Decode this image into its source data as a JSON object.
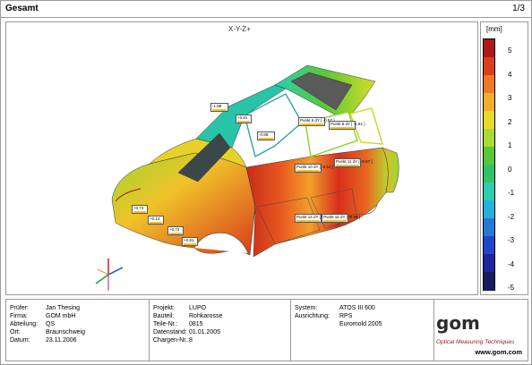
{
  "header": {
    "title": "Gesamt",
    "page": "1/3"
  },
  "view": {
    "label": "X-Y-Z+"
  },
  "legend": {
    "unit": "[mm]",
    "ticks": [
      "5",
      "4",
      "3",
      "2",
      "1",
      "0",
      "-1",
      "-2",
      "-3",
      "-4",
      "-5"
    ],
    "colors": [
      "#b01818",
      "#d8401c",
      "#ee7a22",
      "#f6ae2a",
      "#e8da2a",
      "#a8dc30",
      "#58c838",
      "#2fc46a",
      "#2ccdb0",
      "#28b0dc",
      "#2878d8",
      "#2046c8",
      "#1e249c",
      "#181a5e"
    ]
  },
  "callouts": [
    {
      "id": "c1",
      "text": "-1.88"
    },
    {
      "id": "c2",
      "text": "+0.81"
    },
    {
      "id": "c3",
      "text": "-0.89"
    },
    {
      "id": "c4",
      "text": "Punkt 6  dY [ -0.57 ]"
    },
    {
      "id": "c5",
      "text": "Punkt 8  dY [ -1.81 ]"
    },
    {
      "id": "c6",
      "text": "Punkt 10  dY [ -0.11 ]"
    },
    {
      "id": "c7",
      "text": "Punkt 11  dY [ -0.67 ]"
    },
    {
      "id": "c8",
      "text": "Punkt 14  dY [ -0.85 ]"
    },
    {
      "id": "c9",
      "text": "Punkt 15  dY [ -0.89 ]"
    },
    {
      "id": "c10",
      "text": "+0.73"
    },
    {
      "id": "c11",
      "text": "+0.14"
    },
    {
      "id": "c12",
      "text": "+0.73"
    },
    {
      "id": "c13",
      "text": "+0.81"
    }
  ],
  "info": {
    "col1": [
      {
        "label": "Prüfer:",
        "value": "Jan Thesing"
      },
      {
        "label": "Firma:",
        "value": "GOM mbH"
      },
      {
        "label": "Abteilung:",
        "value": "QS"
      },
      {
        "label": "Ort:",
        "value": "Braunschweig"
      },
      {
        "label": "Datum:",
        "value": "23.11.2006"
      }
    ],
    "col2": [
      {
        "label": "Projekt:",
        "value": "LUPO"
      },
      {
        "label": "Bauteil:",
        "value": "Rohkarosse"
      },
      {
        "label": "Teile-Nr.:",
        "value": "0815"
      },
      {
        "label": "Datenstand:",
        "value": "01.01.2005"
      },
      {
        "label": "Chargen-Nr.:",
        "value": "8"
      }
    ],
    "col3": [
      {
        "label": "System:",
        "value": "ATOS III 600"
      },
      {
        "label": "Ausrichtung:",
        "value": "RPS"
      },
      {
        "label": "",
        "value": "Euromold 2005"
      }
    ]
  },
  "logo": {
    "brand": "gom",
    "tagline": "Optical Measuring Techniques",
    "url": "www.gom.com"
  }
}
